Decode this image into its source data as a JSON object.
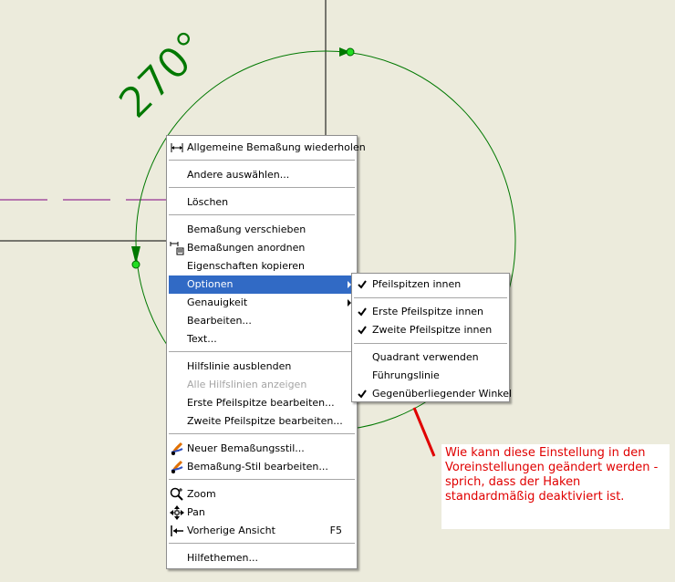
{
  "drawing": {
    "angle_label": "270°",
    "colors": {
      "arc": "#007800",
      "centerline": "#800080",
      "leader": "#e00000",
      "highlight": "#316ac5"
    }
  },
  "context_menu": {
    "items": [
      {
        "label": "Allgemeine Bemaßung wiederholen",
        "icon": "dimension-icon"
      },
      {
        "label": "Andere auswählen..."
      },
      {
        "label": "Löschen"
      },
      {
        "label": "Bemaßung verschieben"
      },
      {
        "label": "Bemaßungen anordnen",
        "icon": "arrange-dimensions-icon"
      },
      {
        "label": "Eigenschaften kopieren"
      },
      {
        "label": "Optionen",
        "submenu": true,
        "highlighted": true
      },
      {
        "label": "Genauigkeit",
        "submenu": true
      },
      {
        "label": "Bearbeiten..."
      },
      {
        "label": "Text..."
      },
      {
        "label": "Hilfslinie ausblenden"
      },
      {
        "label": "Alle Hilfslinien anzeigen",
        "disabled": true
      },
      {
        "label": "Erste Pfeilspitze bearbeiten..."
      },
      {
        "label": "Zweite Pfeilspitze bearbeiten..."
      },
      {
        "label": "Neuer Bemaßungsstil...",
        "icon": "style-icon"
      },
      {
        "label": "Bemaßung-Stil bearbeiten...",
        "icon": "style-icon"
      },
      {
        "label": "Zoom",
        "icon": "zoom-icon"
      },
      {
        "label": "Pan",
        "icon": "pan-icon"
      },
      {
        "label": "Vorherige Ansicht",
        "shortcut": "F5",
        "icon": "previous-view-icon"
      },
      {
        "label": "Hilfethemen..."
      }
    ]
  },
  "options_submenu": {
    "items": [
      {
        "label": "Pfeilspitzen innen",
        "checked": true
      },
      {
        "label": "Erste Pfeilspitze innen",
        "checked": true
      },
      {
        "label": "Zweite Pfeilspitze innen",
        "checked": true
      },
      {
        "label": "Quadrant verwenden",
        "checked": false
      },
      {
        "label": "Führungslinie",
        "checked": false
      },
      {
        "label": "Gegenüberliegender Winkel",
        "checked": true
      }
    ]
  },
  "annotation": {
    "text": "Wie kann diese Einstellung in den Voreinstellungen geändert werden - sprich, dass der Haken standardmäßig deaktiviert ist."
  }
}
